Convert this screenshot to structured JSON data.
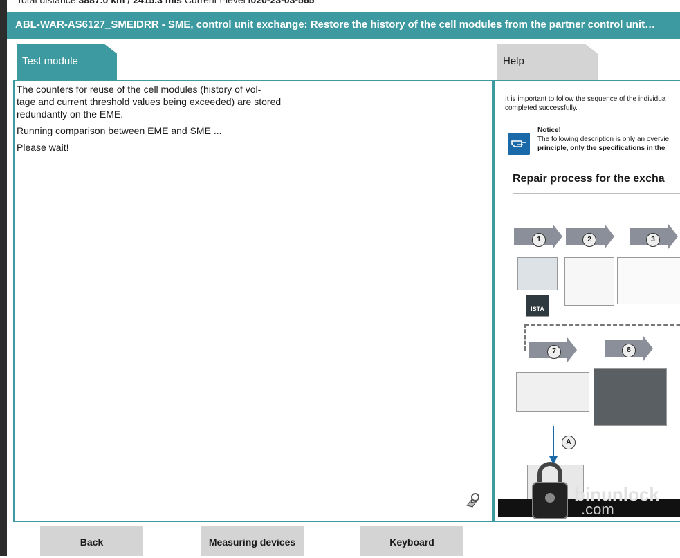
{
  "top_info": {
    "distance_label": "Total distance",
    "distance_value": "3887.0 km / 2415.3 mls",
    "ilevel_label": "Current I-level",
    "ilevel_value": "I020-23-03-565"
  },
  "title_bar": {
    "title": "ABL-WAR-AS6127_SMEIDRR - SME, control unit exchange: Restore the history of the cell modules from the partner control unit…"
  },
  "tabs": {
    "test_module": "Test module",
    "help": "Help"
  },
  "main_panel": {
    "line1": "The counters for reuse of the cell modules (history of vol-",
    "line2": "tage and current threshold values being exceeded) are stored",
    "line3": "redundantly on the EME.",
    "para2": "Running comparison between EME and SME ...",
    "para3": "Please wait!"
  },
  "help_panel": {
    "intro_line1": "It is important to follow the sequence of the individua",
    "intro_line2": "completed successfully.",
    "notice_title": "Notice!",
    "notice_line1": "The following description is only an overvie",
    "notice_line2": "principle, only the specifications in the",
    "heading": "Repair process for the excha",
    "steps": [
      "1",
      "2",
      "3",
      "7",
      "8"
    ],
    "marker_a": "A",
    "ista_label": "ISTA"
  },
  "bottom_buttons": {
    "back": "Back",
    "measuring_devices": "Measuring devices",
    "keyboard": "Keyboard"
  },
  "watermark": {
    "line1": "binunlock",
    "line2": ".com"
  },
  "colors": {
    "accent": "#3c9aa0",
    "tab_inactive": "#d4d4d4",
    "notice_blue": "#1a6aaa"
  }
}
